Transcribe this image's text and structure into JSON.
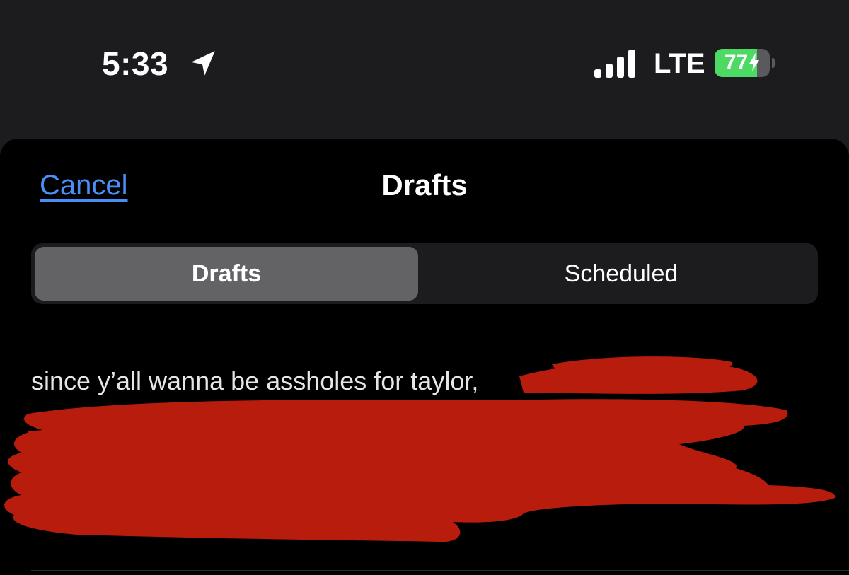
{
  "status_bar": {
    "time": "5:33",
    "network": "LTE",
    "battery_percent": 77,
    "battery_label": "77",
    "charging": true,
    "icons": [
      "location-arrow-icon",
      "signal-bars-icon",
      "battery-icon",
      "bolt-icon"
    ]
  },
  "sheet": {
    "cancel_label": "Cancel",
    "title": "Drafts"
  },
  "tabs": [
    {
      "label": "Drafts",
      "selected": true
    },
    {
      "label": "Scheduled",
      "selected": false
    }
  ],
  "drafts": [
    {
      "text": "since y’all wanna be assholes for taylor,",
      "redacted": true
    }
  ],
  "colors": {
    "background": "#1c1c1e",
    "sheet": "#000000",
    "link": "#4a8ff7",
    "segment_selected": "#636366",
    "battery": "#4cd964",
    "redaction": "#b71c0c"
  }
}
